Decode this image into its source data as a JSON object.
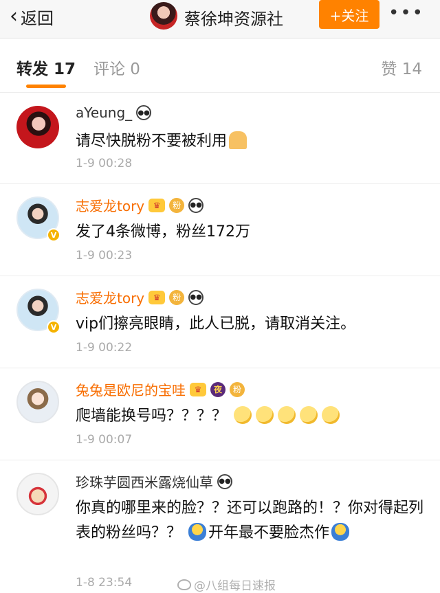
{
  "header": {
    "back_label": "返回",
    "title": "蔡徐坤资源社",
    "follow_label": "+关注",
    "more_label": "•••"
  },
  "tabs": {
    "repost": "转发 17",
    "comment": "评论 0",
    "like": "赞 14"
  },
  "comments": [
    {
      "username": "aYeung_",
      "verified": false,
      "badges": [
        "panda"
      ],
      "content": "请尽快脱粉不要被利用",
      "time": "1-9 00:28"
    },
    {
      "username": "志爱龙tory",
      "verified": true,
      "badges": [
        "crown",
        "fan",
        "panda"
      ],
      "content": "发了4条微博，粉丝172万",
      "time": "1-9 00:23"
    },
    {
      "username": "志爱龙tory",
      "verified": true,
      "badges": [
        "crown",
        "fan",
        "panda"
      ],
      "content": "vip们擦亮眼睛，此人已脱，请取消关注。",
      "time": "1-9 00:22"
    },
    {
      "username": "兔兔是欧尼的宝哇",
      "verified": false,
      "badges": [
        "crown",
        "night",
        "fan"
      ],
      "content": "爬墙能换号吗？？？？",
      "time": "1-9 00:07"
    },
    {
      "username": "珍珠芋圆西米露烧仙草",
      "verified": false,
      "badges": [
        "panda"
      ],
      "content_part1": "你真的哪里来的脸？？还可以跑路的！？你对得起列表的粉丝吗？？",
      "content_part2": "开年最不要脸杰作",
      "time": "1-8 23:54"
    }
  ],
  "badge_labels": {
    "night": "夜",
    "fan": "粉"
  },
  "watermark": "@八组每日速报",
  "colors": {
    "accent": "#ff8200",
    "vip_name": "#f86d00",
    "time": "#aaaaaa"
  }
}
